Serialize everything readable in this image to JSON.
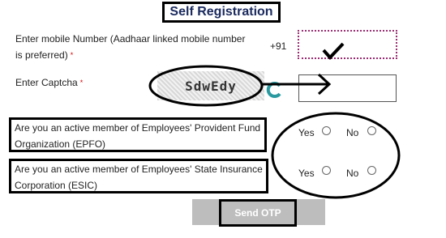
{
  "header": {
    "title": "Self Registration"
  },
  "mobile": {
    "label_line1": "Enter mobile Number (Aadhaar linked mobile number",
    "label_line2": "is preferred)",
    "required_mark": "*",
    "prefix": "+91",
    "value": ""
  },
  "captcha": {
    "label": "Enter Captcha",
    "required_mark": "*",
    "image_text": "SdwEdy",
    "refresh_icon": "refresh-icon",
    "value": ""
  },
  "questions": [
    {
      "line1": "Are you an active member of Employees' Provident Fund",
      "line2": "Organization (EPFO)",
      "yes_label": "Yes",
      "no_label": "No"
    },
    {
      "line1": "Are you an active member of Employees' State Insurance",
      "line2": "Corporation (ESIC)",
      "yes_label": "Yes",
      "no_label": "No"
    }
  ],
  "actions": {
    "send_otp_label": "Send OTP"
  },
  "colors": {
    "title_text": "#1a2a5e",
    "required": "#dd0000",
    "input_border": "#9b2c73",
    "refresh": "#2a9aa0",
    "button_bg": "#bdbdbd"
  }
}
